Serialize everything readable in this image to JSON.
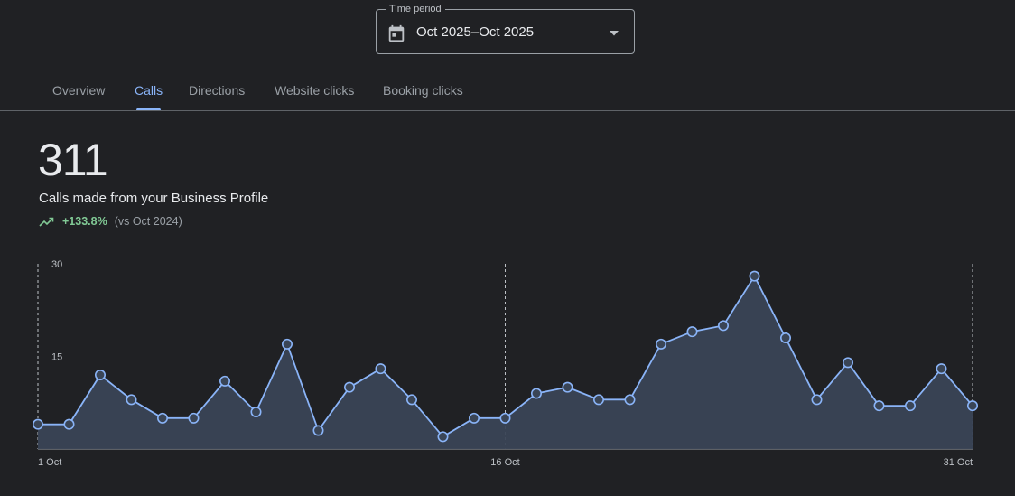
{
  "time_period": {
    "label": "Time period",
    "value": "Oct 2025–Oct 2025"
  },
  "tabs": [
    {
      "label": "Overview",
      "active": false
    },
    {
      "label": "Calls",
      "active": true
    },
    {
      "label": "Directions",
      "active": false
    },
    {
      "label": "Website clicks",
      "active": false
    },
    {
      "label": "Booking clicks",
      "active": false
    }
  ],
  "metric": {
    "value": "311",
    "caption": "Calls made from your Business Profile",
    "change": "+133.8%",
    "comparison": "(vs Oct 2024)"
  },
  "colors": {
    "background": "#202124",
    "accent": "#8ab4f8",
    "positive": "#81c995",
    "area_fill": "#3a4556"
  },
  "chart_data": {
    "type": "area",
    "title": "",
    "xlabel": "",
    "ylabel": "",
    "ylim": [
      0,
      30
    ],
    "y_ticks": [
      "15",
      "30"
    ],
    "x_tick_labels": [
      {
        "day": 1,
        "label": "1 Oct"
      },
      {
        "day": 16,
        "label": "16 Oct"
      },
      {
        "day": 31,
        "label": "31 Oct"
      }
    ],
    "x": [
      1,
      2,
      3,
      4,
      5,
      6,
      7,
      8,
      9,
      10,
      11,
      12,
      13,
      14,
      15,
      16,
      17,
      18,
      19,
      20,
      21,
      22,
      23,
      24,
      25,
      26,
      27,
      28,
      29,
      30,
      31
    ],
    "series": [
      {
        "values": [
          4,
          4,
          12,
          8,
          5,
          5,
          11,
          6,
          17,
          3,
          10,
          13,
          8,
          2,
          5,
          5,
          9,
          10,
          8,
          8,
          17,
          19,
          20,
          28,
          18,
          8,
          14,
          7,
          7,
          13,
          7
        ]
      }
    ]
  }
}
